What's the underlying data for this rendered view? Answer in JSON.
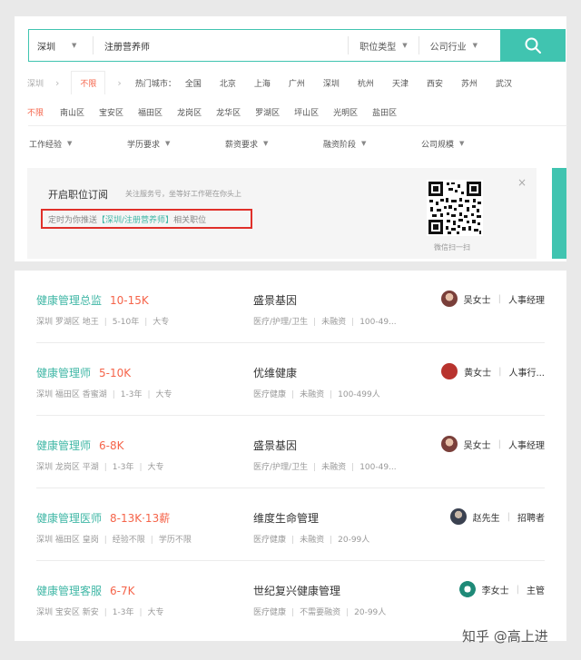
{
  "search": {
    "city": "深圳",
    "query": "注册营养师",
    "job_type_label": "职位类型",
    "industry_label": "公司行业"
  },
  "city_row": {
    "current": "深圳",
    "unlimited": "不限",
    "hot_label": "热门城市：",
    "cities": [
      "全国",
      "北京",
      "上海",
      "广州",
      "深圳",
      "杭州",
      "天津",
      "西安",
      "苏州",
      "武汉"
    ]
  },
  "districts": [
    "不限",
    "南山区",
    "宝安区",
    "福田区",
    "龙岗区",
    "龙华区",
    "罗湖区",
    "坪山区",
    "光明区",
    "盐田区"
  ],
  "filters": [
    "工作经验",
    "学历要求",
    "薪资要求",
    "融资阶段",
    "公司规模"
  ],
  "subscription": {
    "title": "开启职位订阅",
    "hint": "关注服务号，坐等好工作砸在你头上",
    "push_prefix": "定时为你推送",
    "push_keyword": "【深圳/注册营养师】",
    "push_suffix": "相关职位",
    "qr_label": "微信扫一扫",
    "close": "×"
  },
  "jobs": [
    {
      "title": "健康管理总监",
      "salary": "10-15K",
      "location": "深圳 罗湖区 地王",
      "experience": "5-10年",
      "education": "大专",
      "company": "盛景基因",
      "industry": "医疗/护理/卫生",
      "funding": "未融资",
      "size": "100-49...",
      "recruiter": "吴女士",
      "role": "人事经理",
      "avatar_color": "#7a3f3a"
    },
    {
      "title": "健康管理师",
      "salary": "5-10K",
      "location": "深圳 福田区 香蜜湖",
      "experience": "1-3年",
      "education": "大专",
      "company": "优维健康",
      "industry": "医疗健康",
      "funding": "未融资",
      "size": "100-499人",
      "recruiter": "黄女士",
      "role": "人事行...",
      "avatar_color": "#b8332e"
    },
    {
      "title": "健康管理师",
      "salary": "6-8K",
      "location": "深圳 龙岗区 平湖",
      "experience": "1-3年",
      "education": "大专",
      "company": "盛景基因",
      "industry": "医疗/护理/卫生",
      "funding": "未融资",
      "size": "100-49...",
      "recruiter": "吴女士",
      "role": "人事经理",
      "avatar_color": "#7a3f3a"
    },
    {
      "title": "健康管理医师",
      "salary": "8-13K·13薪",
      "location": "深圳 福田区 皇岗",
      "experience": "经验不限",
      "education": "学历不限",
      "company": "维度生命管理",
      "industry": "医疗健康",
      "funding": "未融资",
      "size": "20-99人",
      "recruiter": "赵先生",
      "role": "招聘者",
      "avatar_color": "#3a4150"
    },
    {
      "title": "健康管理客服",
      "salary": "6-7K",
      "location": "深圳 宝安区 新安",
      "experience": "1-3年",
      "education": "大专",
      "company": "世纪复兴健康管理",
      "industry": "医疗健康",
      "funding": "不需要融资",
      "size": "20-99人",
      "recruiter": "李女士",
      "role": "主管",
      "avatar_color": "#1f8a78"
    }
  ],
  "watermark": "知乎 @高上进",
  "colors": {
    "accent": "#40c4b0",
    "salary": "#f5644a",
    "highlight_border": "#e0302a"
  }
}
